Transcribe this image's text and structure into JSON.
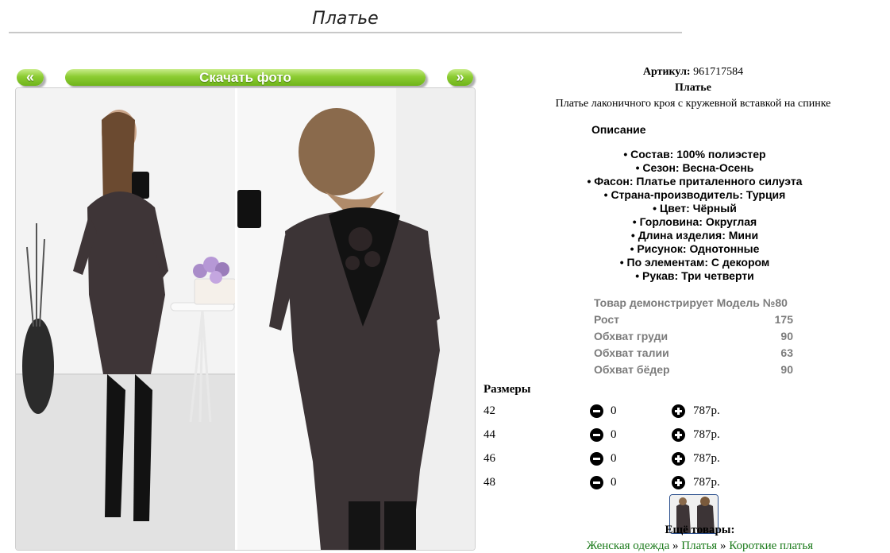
{
  "page": {
    "title": "Платье"
  },
  "gallery": {
    "prev_label": "«",
    "download_label": "Скачать фото",
    "next_label": "»"
  },
  "product": {
    "article_label": "Артикул:",
    "article_value": "961717584",
    "name": "Платье",
    "subtitle": "Платье лаконичного кроя с кружевной вставкой на спинке",
    "description_heading": "Описание",
    "features": [
      "• Состав: 100% полиэстер",
      "• Сезон: Весна-Осень",
      "• Фасон: Платье приталенного силуэта",
      "• Страна-производитель: Турция",
      "• Цвет: Чёрный",
      "• Горловина: Округлая",
      "• Длина изделия: Мини",
      "• Рисунок: Однотонные",
      "• По элементам: С декором",
      "• Рукав: Три четверти"
    ]
  },
  "model": {
    "heading": "Товар демонстрирует Модель №80",
    "rows": [
      {
        "label": "Рост",
        "value": "175"
      },
      {
        "label": "Обхват груди",
        "value": "90"
      },
      {
        "label": "Обхват талии",
        "value": "63"
      },
      {
        "label": "Обхват бёдер",
        "value": "90"
      }
    ]
  },
  "sizes": {
    "heading": "Размеры",
    "rows": [
      {
        "size": "42",
        "qty": "0",
        "price": "787р."
      },
      {
        "size": "44",
        "qty": "0",
        "price": "787р."
      },
      {
        "size": "46",
        "qty": "0",
        "price": "787р."
      },
      {
        "size": "48",
        "qty": "0",
        "price": "787р."
      }
    ]
  },
  "more": {
    "heading": "Ещё товары:",
    "crumbs": [
      "Женская одежда",
      "Платья",
      "Короткие платья"
    ],
    "separator": "»"
  },
  "colors": {
    "accent_green": "#8ccc32",
    "link_green": "#1a7a1a",
    "muted_gray": "#7c7c7c"
  },
  "icons": [
    "minus-circle-icon",
    "plus-circle-icon"
  ]
}
